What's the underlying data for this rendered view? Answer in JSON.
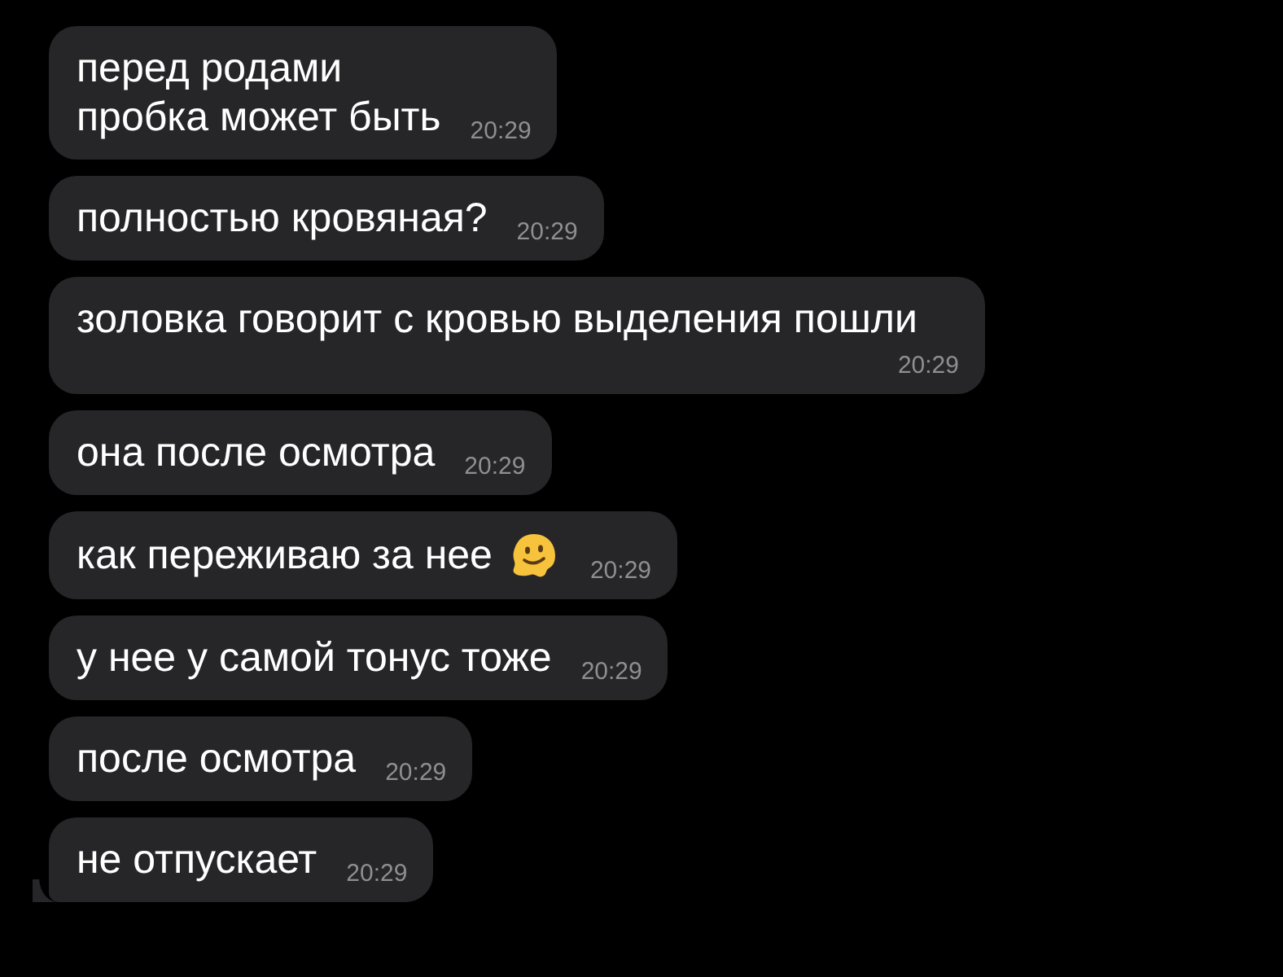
{
  "messages": [
    {
      "lines": [
        "перед родами",
        "пробка может быть"
      ],
      "time": "20:29",
      "emoji": false,
      "tail": false
    },
    {
      "lines": [
        "полностью кровяная?"
      ],
      "time": "20:29",
      "emoji": false,
      "tail": false
    },
    {
      "lines": [
        "золовка говорит с кровью выделения пошли"
      ],
      "time": "20:29",
      "emoji": false,
      "tail": false
    },
    {
      "lines": [
        "она после осмотра"
      ],
      "time": "20:29",
      "emoji": false,
      "tail": false
    },
    {
      "lines": [
        "как переживаю за нее"
      ],
      "time": "20:29",
      "emoji": true,
      "tail": false
    },
    {
      "lines": [
        "у нее у самой тонус тоже"
      ],
      "time": "20:29",
      "emoji": false,
      "tail": false
    },
    {
      "lines": [
        "после осмотра"
      ],
      "time": "20:29",
      "emoji": false,
      "tail": false
    },
    {
      "lines": [
        "не отпускает"
      ],
      "time": "20:29",
      "emoji": false,
      "tail": true
    }
  ]
}
